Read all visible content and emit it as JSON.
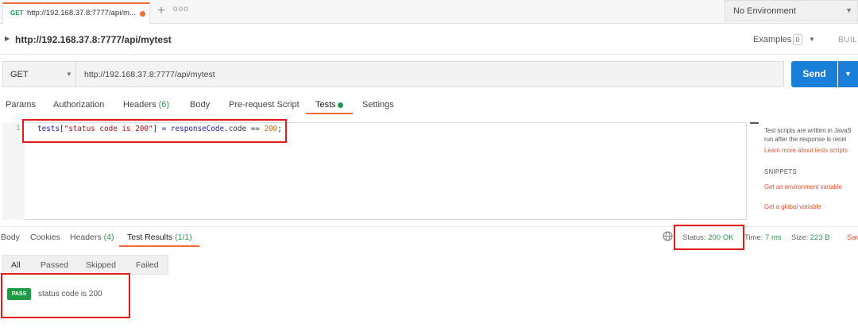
{
  "tab": {
    "method": "GET",
    "title": "http://192.168.37.8:7777/api/m...",
    "new_tab": "+",
    "more": "ooo"
  },
  "environment": {
    "label": "No Environment"
  },
  "breadcrumb": {
    "title": "http://192.168.37.8:7777/api/mytest",
    "examples_label": "Examples",
    "examples_count": "0",
    "build_label": "BUILD"
  },
  "request": {
    "method": "GET",
    "url": "http://192.168.37.8:7777/api/mytest",
    "send_label": "Send"
  },
  "request_tabs": {
    "params": "Params",
    "authorization": "Authorization",
    "headers": "Headers",
    "headers_count": "(6)",
    "body": "Body",
    "prerequest": "Pre-request Script",
    "tests": "Tests",
    "settings": "Settings"
  },
  "editor": {
    "line_number": "1",
    "code_prefix": "tests[",
    "code_string": "\"status code is 200\"",
    "code_middle": "] = responseCode.",
    "code_prop": "code",
    "code_op": " == ",
    "code_number": "200",
    "code_end": ";"
  },
  "help": {
    "line1": "Test scripts are written in JavaS",
    "line2": "run after the response is recei",
    "learn_more": "Learn more about tests scripts",
    "snippets_title": "SNIPPETS",
    "snippet_1": "Get an environment variable",
    "snippet_2": "Get a global variable"
  },
  "response_tabs": {
    "body": "Body",
    "cookies": "Cookies",
    "headers": "Headers",
    "headers_count": "(4)",
    "test_results": "Test Results",
    "test_results_count": "(1/1)"
  },
  "response_meta": {
    "status_label": "Status:",
    "status_value": "200 OK",
    "time_label": "Time:",
    "time_value": "7 ms",
    "size_label": "Size:",
    "size_value": "223 B",
    "save_label": "Sav"
  },
  "filters": [
    "All",
    "Passed",
    "Skipped",
    "Failed"
  ],
  "results": [
    {
      "badge": "PASS",
      "name": "status code is 200"
    }
  ],
  "colors": {
    "accent": "#f26b3a",
    "send": "#1a7fd8",
    "pass": "#1f9b45",
    "highlight_box": "#e31b1b"
  }
}
